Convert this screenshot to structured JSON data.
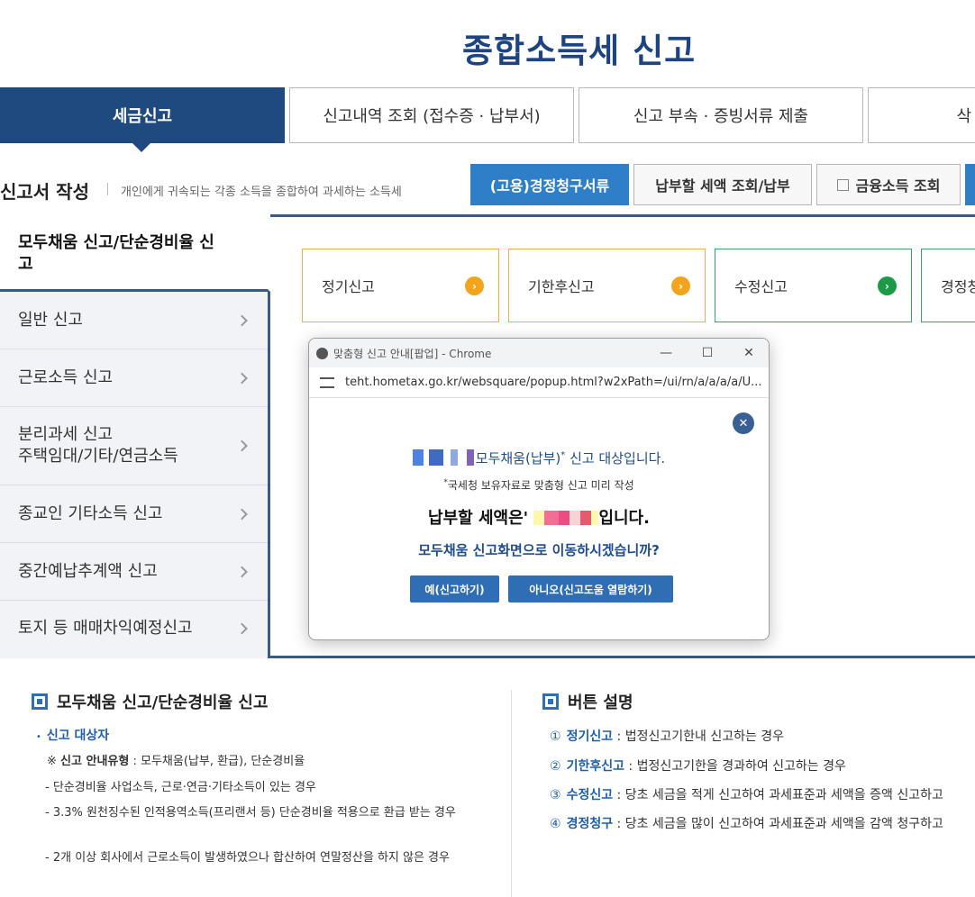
{
  "page_title": "종합소득세 신고",
  "main_tabs": [
    "세금신고",
    "신고내역 조회 (접수증 · 납부서)",
    "신고 부속 · 증빙서류 제출",
    "삭"
  ],
  "section": {
    "title": "신고서 작성",
    "desc": "개인에게 귀속되는 각종 소득을 종합하여 과세하는 소득세"
  },
  "top_buttons": {
    "receipt": "(고용)경정청구서류",
    "tax_lookup": "납부할 세액 조회/납부",
    "finance_lookup": "금융소득 조회"
  },
  "side_menu": {
    "active": "모두채움 신고/단순경비율 신고",
    "items": [
      "일반 신고",
      "근로소득 신고",
      "분리과세 신고\n주택임대/기타/연금소득",
      "종교인 기타소득 신고",
      "중간예납추계액 신고",
      "토지 등 매매차익예정신고"
    ]
  },
  "report_types": [
    "정기신고",
    "기한후신고",
    "수정신고",
    "경정청"
  ],
  "popup": {
    "window_title": "맞춤형 신고 안내[팝업] - Chrome",
    "url": "teht.hometax.go.kr/websquare/popup.html?w2xPath=/ui/rn/a/a/a/a/U...",
    "line1": "모두채움(납부)",
    "line1_mark": "*",
    "line1_suffix": " 신고 대상입니다.",
    "line2_mark": "*",
    "line2": "국세청 보유자료로 맞춤형 신고 미리 작성",
    "line3_prefix": "납부할 세액은'",
    "line3_suffix": "입니다.",
    "line4": "모두채움 신고화면으로 이동하시겠습니까?",
    "yes_button": "예(신고하기)",
    "no_button": "아니오(신고도움 열람하기)"
  },
  "info_left": {
    "heading": "모두채움 신고/단순경비율 신고",
    "target_label": "신고 대상자",
    "guide_mark": "※",
    "guide_label": "신고 안내유형",
    "guide_text": ": 모두채움(납부, 환급), 단순경비율",
    "bullets": [
      "단순경비율 사업소득, 근로·연금·기타소득이 있는 경우",
      "3.3% 원천징수된 인적용역소득(프리랜서 등) 단순경비율 적용으로 환급 받는 경우",
      "2개 이상 회사에서 근로소득이 발생하였으나 합산하여 연말정산을 하지 않은 경우"
    ]
  },
  "info_right": {
    "heading": "버튼 설명",
    "items": [
      {
        "num": "①",
        "label": "정기신고",
        "text": " : 법정신고기한내 신고하는 경우"
      },
      {
        "num": "②",
        "label": "기한후신고",
        "text": " : 법정신고기한을 경과하여 신고하는 경우"
      },
      {
        "num": "③",
        "label": "수정신고",
        "text": " : 당초 세금을 적게 신고하여 과세표준과 세액을 증액 신고하고"
      },
      {
        "num": "④",
        "label": "경정청구",
        "text": " : 당초 세금을 많이 신고하여 과세표준과 세액을 감액 청구하고"
      }
    ]
  }
}
